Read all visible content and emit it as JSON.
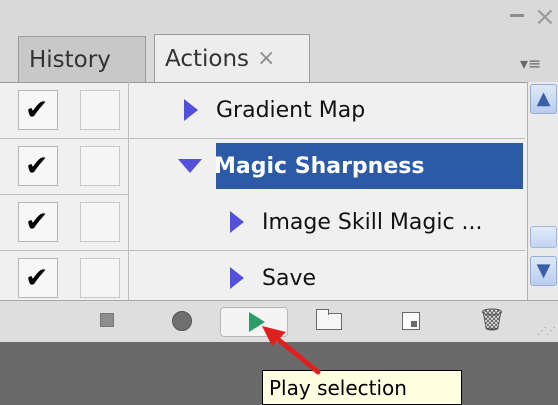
{
  "tabs": [
    {
      "label": "History"
    },
    {
      "label": "Actions",
      "close": "×"
    }
  ],
  "window": {
    "close": "×",
    "menu": "▾≡"
  },
  "actions": [
    {
      "name": "Gradient Map",
      "checked": true,
      "expanded": false,
      "selected": false
    },
    {
      "name": "Magic Sharpness",
      "checked": true,
      "expanded": true,
      "selected": true
    },
    {
      "name": "Image Skill Magic ...",
      "checked": true,
      "expanded": false,
      "selected": false
    },
    {
      "name": "Save",
      "checked": true,
      "expanded": false,
      "selected": false
    }
  ],
  "checkmark": "✔",
  "toolbar": {
    "stop": "stop-icon",
    "record": "record-icon",
    "play": "play-icon",
    "new_set": "folder-icon",
    "new_action": "new-action-icon",
    "delete": "trash-icon",
    "trash_glyph": "🗑"
  },
  "tooltip": {
    "text": "Play selection"
  },
  "scroll": {
    "up": "▲",
    "down": "▼"
  },
  "colors": {
    "selection": "#2d5aa6",
    "triangle": "#5350d9",
    "play": "#2f9b6b",
    "arrow": "#e0201e",
    "tooltip_bg": "#ffffe1"
  }
}
